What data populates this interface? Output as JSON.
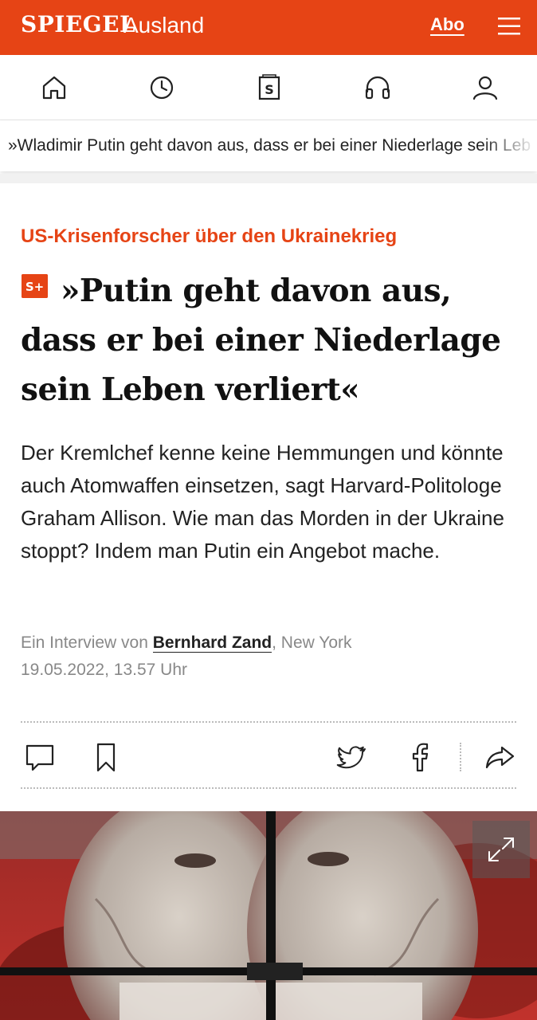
{
  "header": {
    "logo": "SPIEGEL",
    "section": "Ausland",
    "abo_label": "Abo",
    "brand_color": "#e64415",
    "menu_icon": "hamburger-menu-icon"
  },
  "navbar": {
    "icons": [
      "home-icon",
      "clock-icon",
      "spiegel-plus-icon",
      "headphones-icon",
      "user-icon"
    ]
  },
  "ticker": {
    "text": "»Wladimir Putin geht davon aus, dass er bei einer Niederlage sein Leb"
  },
  "article": {
    "kicker": "US-Krisenforscher über den Ukrainekrieg",
    "badge": "S+",
    "headline": "»Putin geht davon aus, dass er bei einer Niederlage sein Leben verliert«",
    "lead": "Der Kremlchef kenne keine Hemmungen und könnte auch Atomwaffen einsetzen, sagt Harvard-Politologe Graham Allison. Wie man das Morden in der Ukraine stoppt? Indem man Putin ein Angebot mache.",
    "byline_prefix": "Ein Interview von",
    "author": "Bernhard Zand",
    "location": ", New York",
    "date": "19.05.2022, 13.57 Uhr"
  },
  "actions": {
    "icons": [
      "comment-icon",
      "bookmark-icon",
      "twitter-icon",
      "facebook-icon",
      "share-icon"
    ]
  },
  "hero": {
    "image_icon": "expand-icon"
  }
}
